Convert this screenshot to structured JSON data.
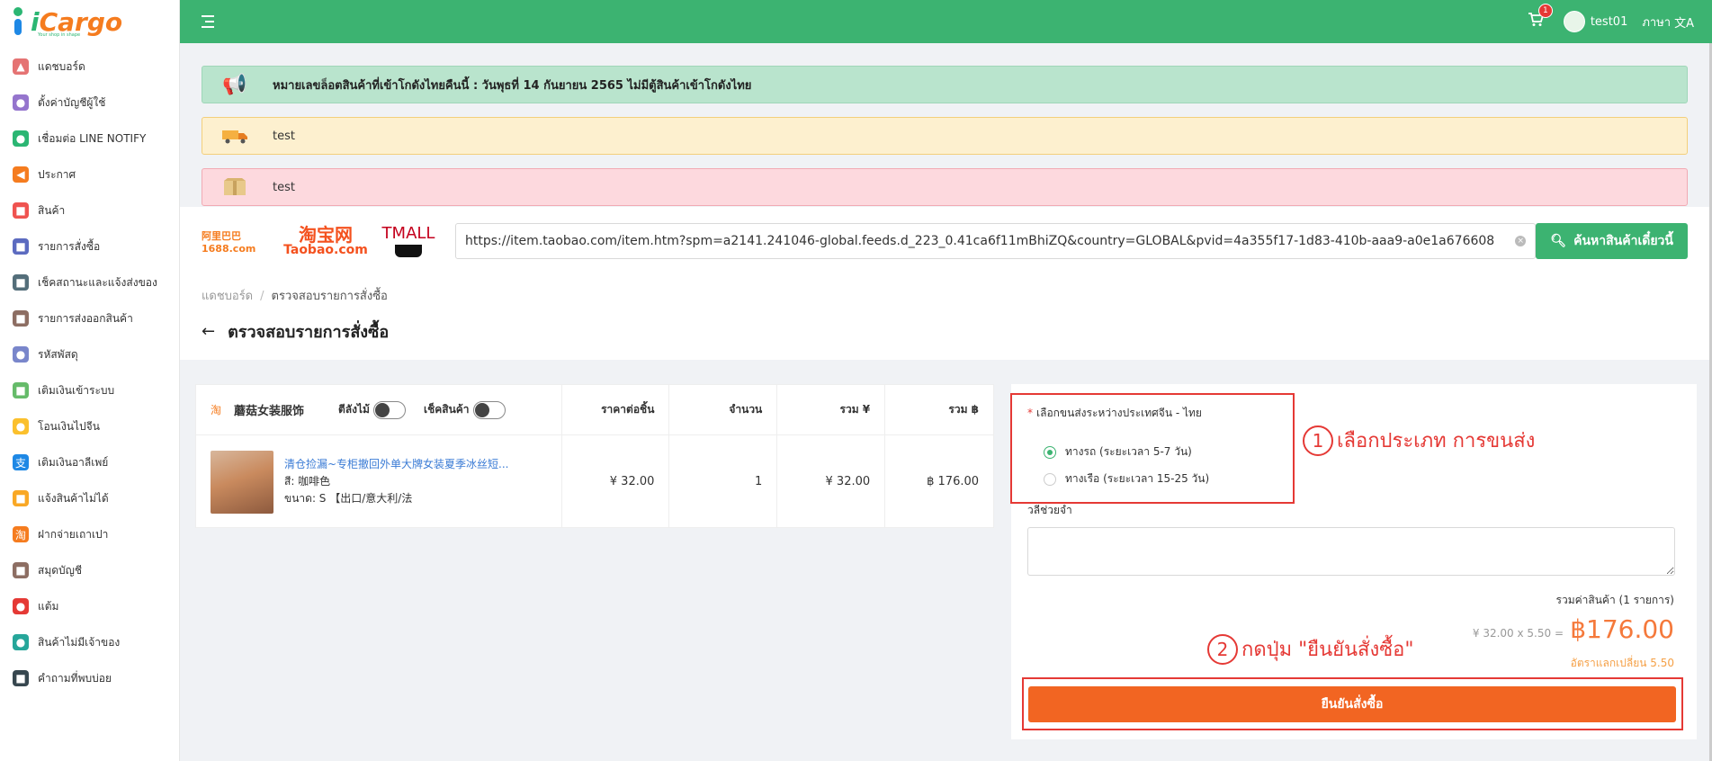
{
  "brand": {
    "logo_i": "i",
    "logo_rest": "Cargo",
    "tagline": "Your shop in shape"
  },
  "sidebar": {
    "items": [
      {
        "label": "แดชบอร์ด",
        "icon": "chart-icon",
        "color": "#e57373",
        "glyph": "▲"
      },
      {
        "label": "ตั้งค่าบัญชีผู้ใช้",
        "icon": "user-settings-icon",
        "color": "#9575cd",
        "glyph": "●"
      },
      {
        "label": "เชื่อมต่อ LINE NOTIFY",
        "icon": "line-icon",
        "color": "#2bb673",
        "glyph": "●"
      },
      {
        "label": "ประกาศ",
        "icon": "megaphone-icon",
        "color": "#f57c1f",
        "glyph": "◀"
      },
      {
        "label": "สินค้า",
        "icon": "product-icon",
        "color": "#ef5350",
        "glyph": "■"
      },
      {
        "label": "รายการสั่งซื้อ",
        "icon": "order-icon",
        "color": "#5c6bc0",
        "glyph": "■"
      },
      {
        "label": "เช็คสถานะและแจ้งส่งของ",
        "icon": "status-icon",
        "color": "#546e7a",
        "glyph": "■"
      },
      {
        "label": "รายการส่งออกสินค้า",
        "icon": "export-icon",
        "color": "#8d6e63",
        "glyph": "■"
      },
      {
        "label": "รหัสพัสดุ",
        "icon": "parcel-code-icon",
        "color": "#7986cb",
        "glyph": "●"
      },
      {
        "label": "เติมเงินเข้าระบบ",
        "icon": "topup-icon",
        "color": "#66bb6a",
        "glyph": "■"
      },
      {
        "label": "โอนเงินไปจีน",
        "icon": "transfer-icon",
        "color": "#fbc02d",
        "glyph": "●"
      },
      {
        "label": "เติมเงินอาลีเพย์",
        "icon": "alipay-icon",
        "color": "#1e88e5",
        "glyph": "支"
      },
      {
        "label": "แจ้งสินค้าไม่ได้",
        "icon": "missing-item-icon",
        "color": "#f9a825",
        "glyph": "■"
      },
      {
        "label": "ฝากจ่ายเถาเปา",
        "icon": "taobao-pay-icon",
        "color": "#f57c1f",
        "glyph": "淘"
      },
      {
        "label": "สมุดบัญชี",
        "icon": "ledger-icon",
        "color": "#8d6e63",
        "glyph": "■"
      },
      {
        "label": "แต้ม",
        "icon": "points-icon",
        "color": "#e53935",
        "glyph": "●"
      },
      {
        "label": "สินค้าไม่มีเจ้าของ",
        "icon": "unowned-item-icon",
        "color": "#26a69a",
        "glyph": "●"
      },
      {
        "label": "คำถามที่พบบ่อย",
        "icon": "faq-icon",
        "color": "#37474f",
        "glyph": "■"
      }
    ]
  },
  "topbar": {
    "cart_count": "1",
    "username": "test01",
    "language": "ภาษา",
    "lang_glyph": "文A"
  },
  "alerts": {
    "green": "หมายเลขล็อตสินค้าที่เข้าโกดังไทยคืนนี้ : วันพุธที่ 14 กันยายน 2565 ไม่มีตู้สินค้าเข้าโกดังไทย",
    "yellow": "test",
    "red": "test"
  },
  "marketplaces": {
    "m1688": "阿里巴巴 1688.com",
    "taobao_cn": "淘宝网",
    "taobao_en": "Taobao.com",
    "tmall": "TMALL"
  },
  "search": {
    "url": "https://item.taobao.com/item.htm?spm=a2141.241046-global.feeds.d_223_0.41ca6f11mBhiZQ&country=GLOBAL&pvid=4a355f17-1d83-410b-aaa9-a0e1a676608",
    "button": "ค้นหาสินค้าเดี๋ยวนี้"
  },
  "breadcrumb": {
    "home": "แดชบอร์ด",
    "sep": "/",
    "current": "ตรวจสอบรายการสั่งซื้อ"
  },
  "page_title": "ตรวจสอบรายการสั่งซื้อ",
  "table": {
    "shop": "蘑菇女装服饰",
    "toggle1": "ตีลังไม้",
    "toggle2": "เช็คสินค้า",
    "headers": [
      "ราคาต่อชิ้น",
      "จำนวน",
      "รวม ¥",
      "รวม ฿"
    ],
    "item": {
      "title": "清仓捡漏~专柜撤回外单大牌女装夏季冰丝短...",
      "color": "สี: 咖啡色",
      "size": "ขนาด: S 【出口/意大利/法",
      "price": "¥ 32.00",
      "qty": "1",
      "sum_cny": "¥ 32.00",
      "sum_thb": "฿ 176.00"
    }
  },
  "shipping": {
    "title": "เลือกขนส่งระหว่างประเทศจีน - ไทย",
    "req": "*",
    "option_truck": "ทางรถ (ระยะเวลา 5-7 วัน)",
    "option_ship": "ทางเรือ (ระยะเวลา 15-25 วัน)",
    "selected": "truck"
  },
  "annotations": {
    "a1_num": "1",
    "a1_text": "เลือกประเภท การขนส่ง",
    "a2_num": "2",
    "a2_text": "กดปุ่ม \"ยืนยันสั่งซื้อ\""
  },
  "note": {
    "label": "วลีช่วยจำ",
    "value": ""
  },
  "summary": {
    "label": "รวมค่าสินค้า (1 รายการ)",
    "calc": "¥ 32.00 x 5.50 =",
    "total": "฿176.00",
    "rate": "อัตราแลกเปลี่ยน 5.50"
  },
  "confirm_button": "ยืนยันสั่งซื้อ",
  "colors": {
    "primary": "#3cb371",
    "accent": "#f26522",
    "annotation": "#e53935"
  }
}
